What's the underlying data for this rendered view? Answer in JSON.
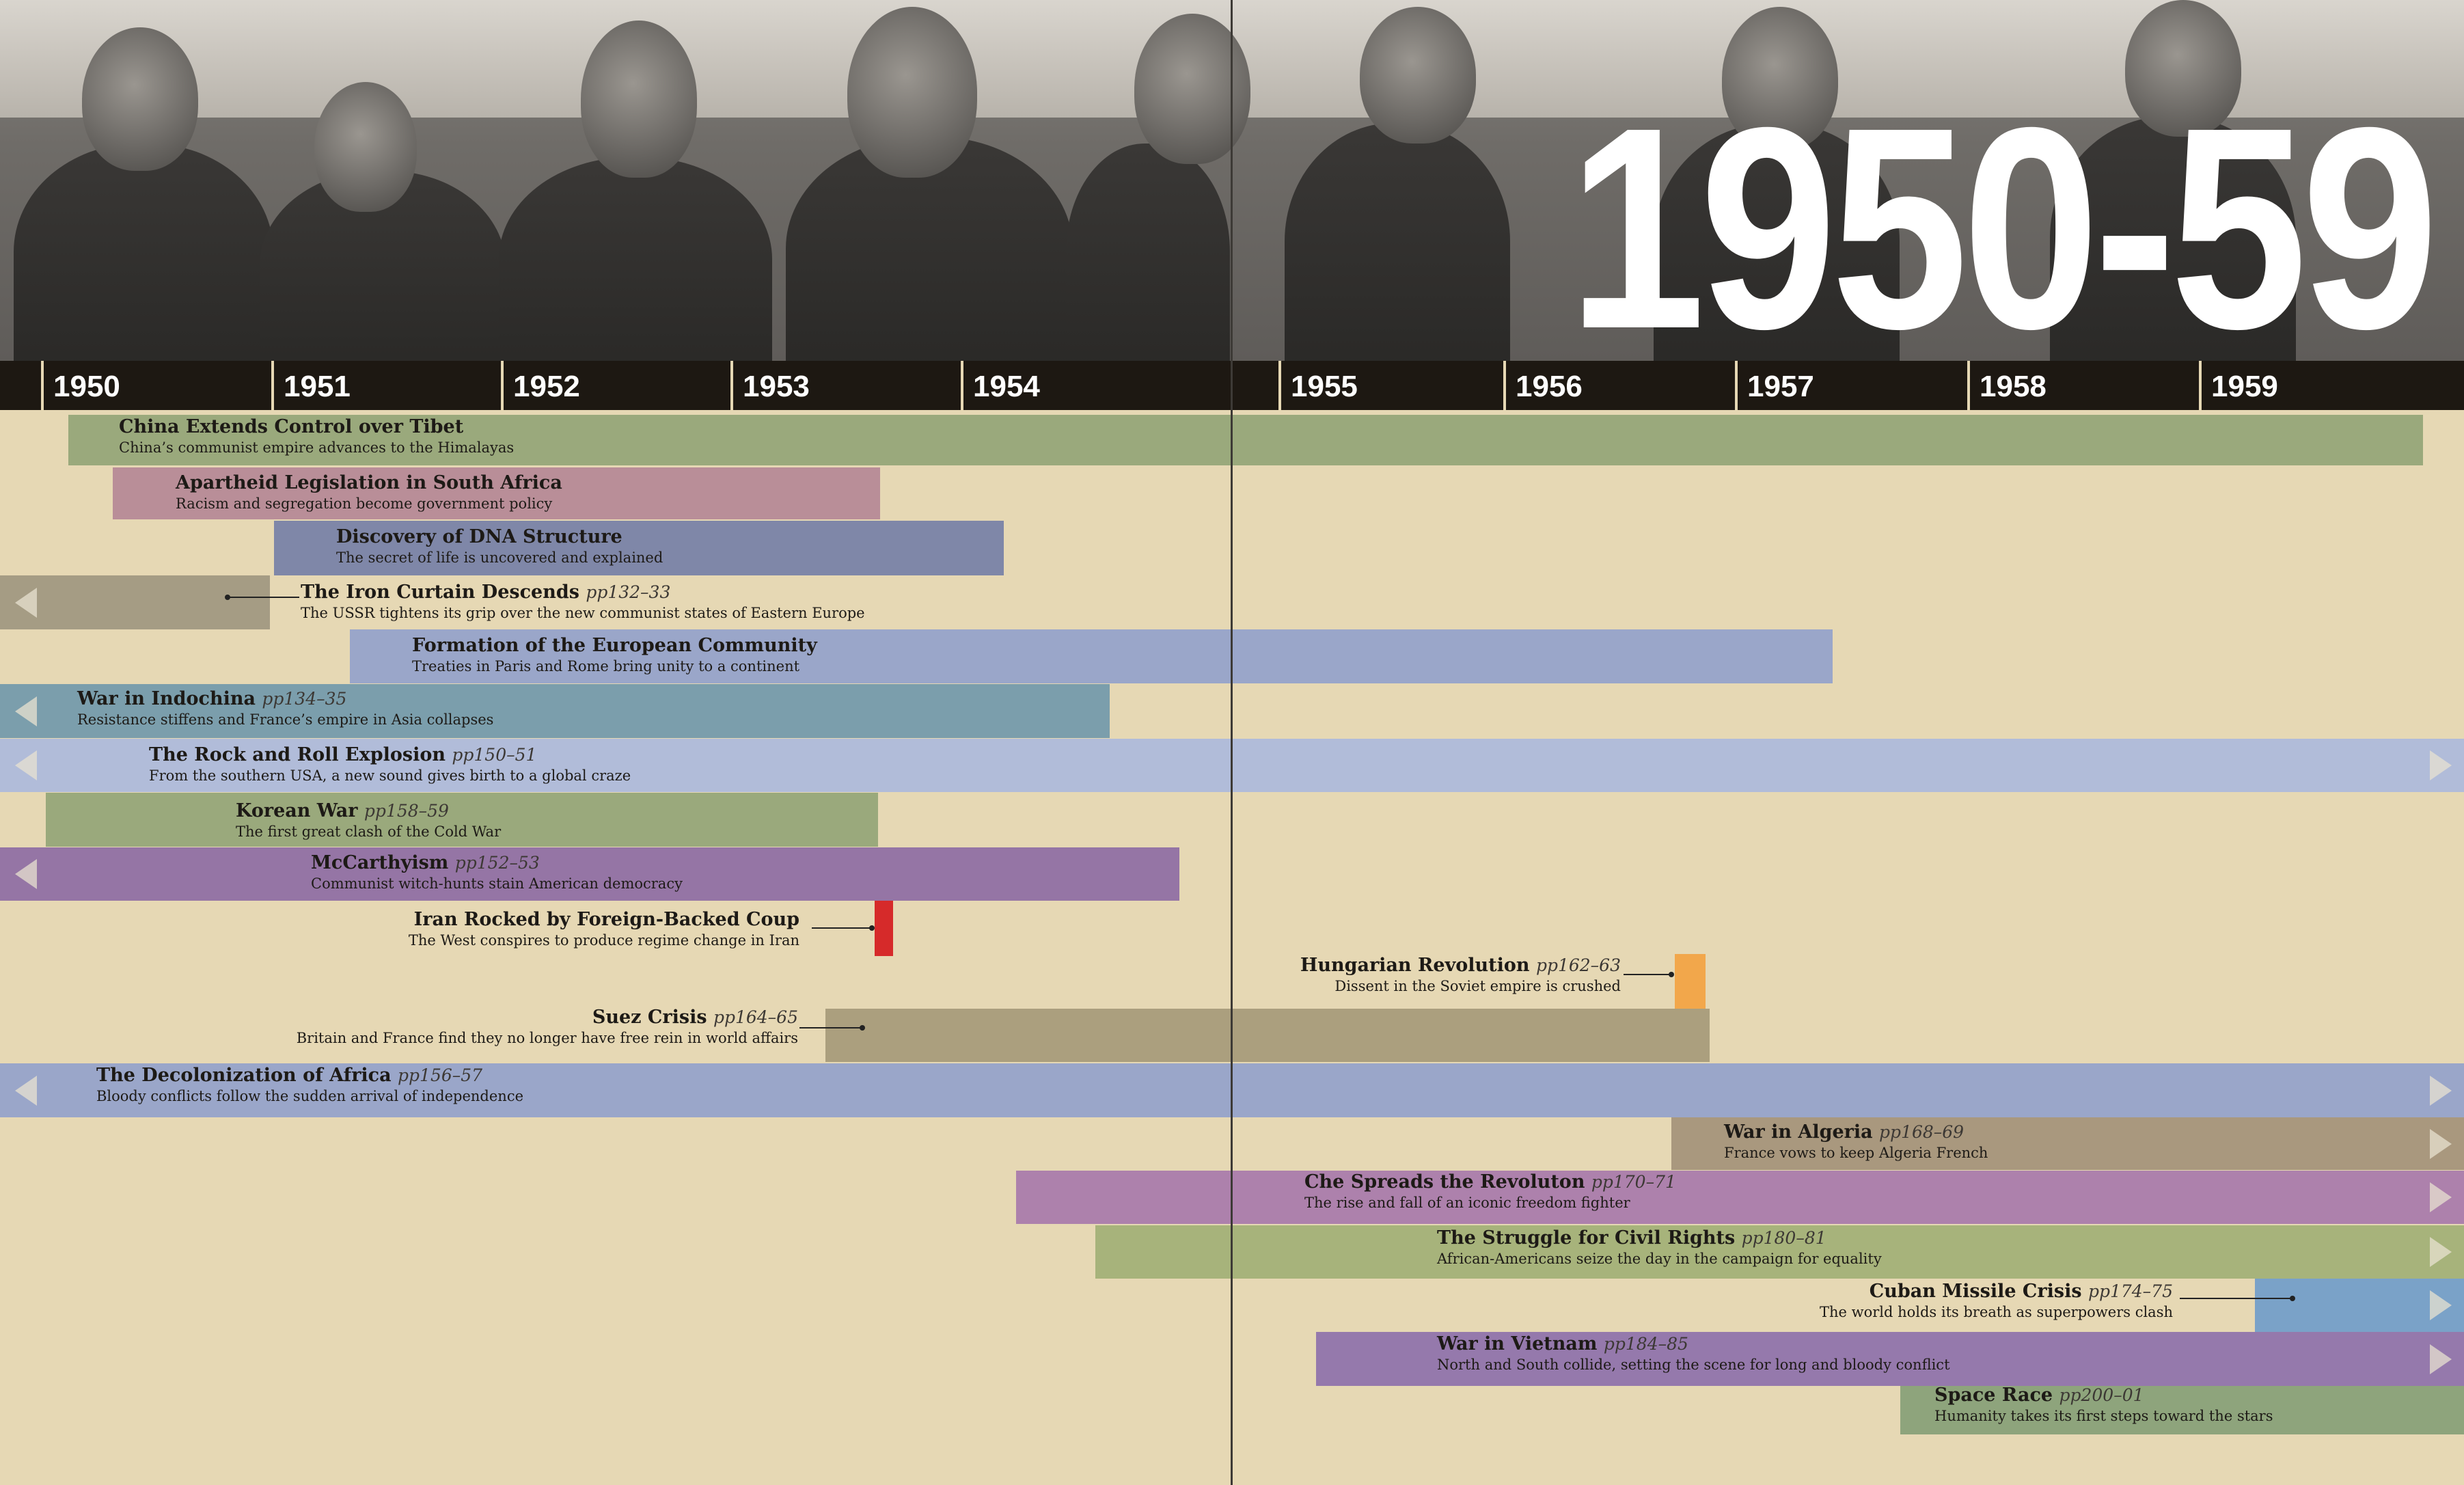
{
  "title": "1950-59",
  "years": [
    "1950",
    "1951",
    "1952",
    "1953",
    "1954",
    "1955",
    "1956",
    "1957",
    "1958",
    "1959"
  ],
  "events": [
    {
      "title": "China Extends Control over Tibet",
      "pages": "",
      "subtitle": "China’s communist empire advances to the Himalayas",
      "color": "#9aa97c"
    },
    {
      "title": "Apartheid Legislation in South Africa",
      "pages": "",
      "subtitle": "Racism and segregation become government policy",
      "color": "#b98e98"
    },
    {
      "title": "Discovery of DNA Structure",
      "pages": "",
      "subtitle": "The secret of life is uncovered and explained",
      "color": "#7f87a8"
    },
    {
      "title": "The Iron Curtain Descends",
      "pages": "pp132–33",
      "subtitle": "The USSR tightens its grip over the new communist states of Eastern Europe",
      "color": "#a59c84"
    },
    {
      "title": "Formation of the European Community",
      "pages": "",
      "subtitle": "Treaties in Paris and Rome bring unity to a continent",
      "color": "#9aa6c9"
    },
    {
      "title": "War in Indochina",
      "pages": "pp134–35",
      "subtitle": "Resistance stiffens and France’s empire in Asia collapses",
      "color": "#7b9eac"
    },
    {
      "title": "The Rock and Roll Explosion",
      "pages": "pp150–51",
      "subtitle": "From the southern USA, a new sound gives birth to a global craze",
      "color": "#b1bcd9"
    },
    {
      "title": "Korean War",
      "pages": "pp158–59",
      "subtitle": "The first great clash of the Cold War",
      "color": "#9aa97c"
    },
    {
      "title": "McCarthyism",
      "pages": "pp152–53",
      "subtitle": "Communist witch-hunts stain American democracy",
      "color": "#9575a5"
    },
    {
      "title": "Iran Rocked by Foreign-Backed Coup",
      "pages": "",
      "subtitle": "The West conspires to produce regime change in Iran",
      "color": "#d62a2a"
    },
    {
      "title": "Hungarian Revolution",
      "pages": "pp162–63",
      "subtitle": "Dissent in the Soviet empire is crushed",
      "color": "#f2a74b"
    },
    {
      "title": "Suez Crisis",
      "pages": "pp164–65",
      "subtitle": "Britain and France find they no longer have free rein in world affairs",
      "color": "#ab9f7e"
    },
    {
      "title": "The Decolonization of Africa",
      "pages": "pp156–57",
      "subtitle": "Bloody conflicts follow the sudden arrival of independence",
      "color": "#9aa6c9"
    },
    {
      "title": "War in Algeria",
      "pages": "pp168–69",
      "subtitle": "France vows to keep Algeria French",
      "color": "#a9987e"
    },
    {
      "title": "Che Spreads the Revoluton",
      "pages": "pp170–71",
      "subtitle": "The rise and fall of an iconic freedom fighter",
      "color": "#ad81ac"
    },
    {
      "title": "The Struggle for Civil Rights",
      "pages": "pp180–81",
      "subtitle": "African-Americans seize the day in the campaign for equality",
      "color": "#a7b37b"
    },
    {
      "title": "Cuban Missile Crisis",
      "pages": "pp174–75",
      "subtitle": "The world holds its breath as superpowers clash",
      "color": "#7aa2c8"
    },
    {
      "title": "War in Vietnam",
      "pages": "pp184–85",
      "subtitle": "North and South collide, setting the scene for long and bloody conflict",
      "color": "#9579ac"
    },
    {
      "title": "Space Race",
      "pages": "pp200–01",
      "subtitle": "Humanity takes its first steps toward the stars",
      "color": "#8ea47c"
    }
  ]
}
